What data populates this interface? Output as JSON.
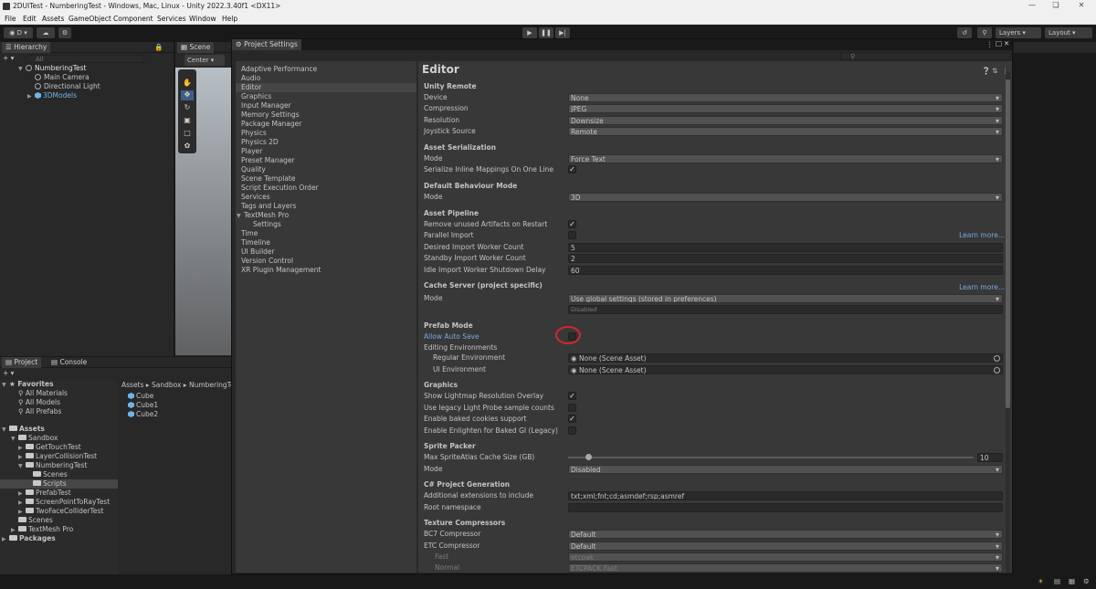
{
  "window_title": "2DUITest - NumberingTest - Windows, Mac, Linux - Unity 2022.3.40f1 <DX11>",
  "menu": [
    "File",
    "Edit",
    "Assets",
    "GameObject",
    "Component",
    "Services",
    "Window",
    "Help"
  ],
  "toolbar": {
    "account": "D",
    "layers": "Layers",
    "layout": "Layout"
  },
  "hierarchy": {
    "tab": "Hierarchy",
    "search_placeholder": "All",
    "items": [
      "NumberingTest",
      "Main Camera",
      "Directional Light",
      "3DModels"
    ]
  },
  "scene": {
    "tab": "Scene",
    "pivot": "Center"
  },
  "project": {
    "tabs": [
      "Project",
      "Console"
    ],
    "favorites": [
      "Favorites",
      "All Materials",
      "All Models",
      "All Prefabs"
    ],
    "assets": [
      "Assets",
      "Sandbox",
      "GetTouchTest",
      "LayerCollisionTest",
      "NumberingTest",
      "Scenes",
      "Scripts",
      "PrefabTest",
      "ScreenPointToRayTest",
      "TwoFaceColliderTest",
      "Scenes",
      "TextMesh Pro",
      "Packages"
    ],
    "breadcrumb": [
      "Assets",
      "Sandbox",
      "NumberingTe"
    ],
    "files": [
      "Cube",
      "Cube1",
      "Cube2"
    ]
  },
  "project_settings": {
    "title": "Project Settings",
    "categories": [
      "Adaptive Performance",
      "Audio",
      "Editor",
      "Graphics",
      "Input Manager",
      "Memory Settings",
      "Package Manager",
      "Physics",
      "Physics 2D",
      "Player",
      "Preset Manager",
      "Quality",
      "Scene Template",
      "Script Execution Order",
      "Services",
      "Tags and Layers",
      "TextMesh Pro",
      "Settings",
      "Time",
      "Timeline",
      "UI Builder",
      "Version Control",
      "XR Plugin Management"
    ],
    "selected": "Editor",
    "page_title": "Editor",
    "learn_more": "Learn more...",
    "unity_remote": {
      "header": "Unity Remote",
      "device_label": "Device",
      "device": "None",
      "compression_label": "Compression",
      "compression": "JPEG",
      "resolution_label": "Resolution",
      "resolution": "Downsize",
      "joystick_label": "Joystick Source",
      "joystick": "Remote"
    },
    "asset_serialization": {
      "header": "Asset Serialization",
      "mode_label": "Mode",
      "mode": "Force Text",
      "inline_label": "Serialize Inline Mappings On One Line"
    },
    "default_behaviour": {
      "header": "Default Behaviour Mode",
      "mode_label": "Mode",
      "mode": "3D"
    },
    "asset_pipeline": {
      "header": "Asset Pipeline",
      "remove_label": "Remove unused Artifacts on Restart",
      "parallel_label": "Parallel Import",
      "desired_label": "Desired Import Worker Count",
      "desired": "5",
      "standby_label": "Standby Import Worker Count",
      "standby": "2",
      "idle_label": "Idle Import Worker Shutdown Delay",
      "idle": "60"
    },
    "cache_server": {
      "header": "Cache Server (project specific)",
      "mode_label": "Mode",
      "mode": "Use global settings (stored in preferences)",
      "status": "Disabled"
    },
    "prefab_mode": {
      "header": "Prefab Mode",
      "auto_save_label": "Allow Auto Save",
      "env_label": "Editing Environments",
      "regular_label": "Regular Environment",
      "regular": "None (Scene Asset)",
      "ui_label": "UI Environment",
      "ui": "None (Scene Asset)"
    },
    "graphics": {
      "header": "Graphics",
      "lightmap_label": "Show Lightmap Resolution Overlay",
      "legacy_label": "Use legacy Light Probe sample counts",
      "cookies_label": "Enable baked cookies support",
      "enlighten_label": "Enable Enlighten for Baked GI (Legacy)"
    },
    "sprite_packer": {
      "header": "Sprite Packer",
      "cache_label": "Max SpriteAtlas Cache Size (GB)",
      "cache": "10",
      "mode_label": "Mode",
      "mode": "Disabled"
    },
    "csharp": {
      "header": "C# Project Generation",
      "ext_label": "Additional extensions to include",
      "ext": "txt;xml;fnt;cd;asmdef;rsp;asmref",
      "ns_label": "Root namespace",
      "ns": ""
    },
    "texture": {
      "header": "Texture Compressors",
      "bc7_label": "BC7 Compressor",
      "bc7": "Default",
      "etc_label": "ETC Compressor",
      "etc": "Default",
      "fast_label": "Fast",
      "fast": "etcpak",
      "normal_label": "Normal",
      "normal": "ETCPACK Fast"
    }
  }
}
